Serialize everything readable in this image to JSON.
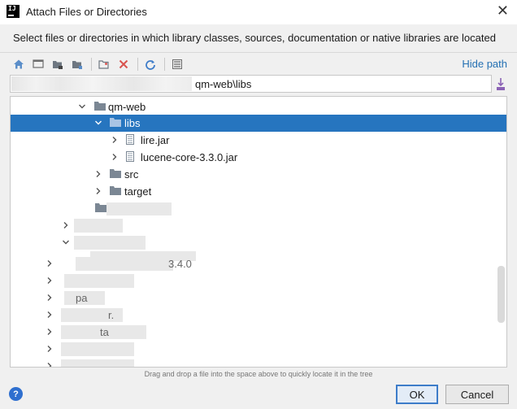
{
  "window": {
    "title": "Attach Files or Directories",
    "app_icon_text": "IJ",
    "close_glyph": "✕"
  },
  "description": "Select files or directories in which library classes, sources, documentation or native libraries are located",
  "toolbar": {
    "icons": [
      "home-icon",
      "desktop-icon",
      "project-icon",
      "module-icon",
      "new-folder-icon",
      "delete-icon",
      "refresh-icon",
      "show-hidden-icon"
    ],
    "hide_path_label": "Hide path"
  },
  "path_field": {
    "visible_value": "qm-web\\libs"
  },
  "tree": {
    "rows": [
      {
        "label": "qm-web",
        "expanded": true,
        "type": "folder"
      },
      {
        "label": "libs",
        "expanded": true,
        "type": "folder",
        "selected": true
      },
      {
        "label": "lire.jar",
        "expanded": false,
        "type": "jar"
      },
      {
        "label": "lucene-core-3.3.0.jar",
        "expanded": false,
        "type": "jar"
      },
      {
        "label": "src",
        "expanded": false,
        "type": "folder"
      },
      {
        "label": "target",
        "expanded": false,
        "type": "folder"
      }
    ],
    "obscured_row_fragments": [
      "3.4.0",
      "pa",
      "r.",
      "ta"
    ]
  },
  "hint": "Drag and drop a file into the space above to quickly locate it in the tree",
  "buttons": {
    "help": "?",
    "ok": "OK",
    "cancel": "Cancel"
  },
  "colors": {
    "selection": "#2675bf",
    "link": "#2470b3",
    "folder": "#7b8794"
  }
}
